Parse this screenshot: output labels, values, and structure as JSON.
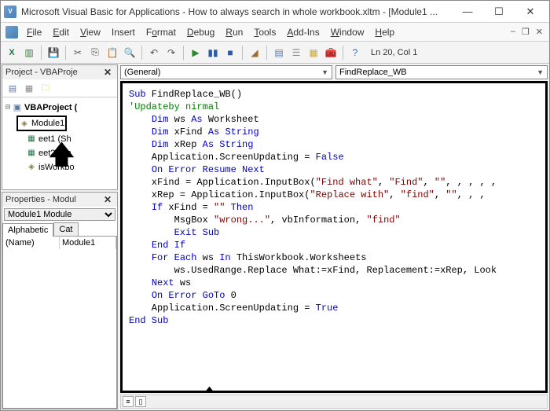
{
  "titlebar": {
    "title": "Microsoft Visual Basic for Applications - How to always search in whole workbook.xltm - [Module1 ..."
  },
  "menu": {
    "file": "File",
    "edit": "Edit",
    "view": "View",
    "insert": "Insert",
    "format": "Format",
    "debug": "Debug",
    "run": "Run",
    "tools": "Tools",
    "addins": "Add-Ins",
    "window": "Window",
    "help": "Help"
  },
  "toolbar": {
    "status": "Ln 20, Col 1"
  },
  "project": {
    "title": "Project - VBAProje",
    "root": "VBAProject (",
    "module1": "Module1",
    "sheet1": "eet1 (Sh",
    "sheet2": "eet2 (Sh",
    "thiswb": "isWorkbo"
  },
  "props": {
    "title": "Properties - Modul",
    "combo_label": "Module1",
    "combo_type": "Module",
    "tab_alpha": "Alphabetic",
    "tab_cat": "Cat",
    "row_name": "(Name)",
    "row_val": "Module1"
  },
  "code_dd": {
    "left": "(General)",
    "right": "FindReplace_WB"
  },
  "code": {
    "l1a": "Sub",
    "l1b": " FindReplace_WB()",
    "l2": "'Updateby nirmal",
    "l3a": "Dim",
    "l3b": " ws ",
    "l3c": "As",
    "l3d": " Worksheet",
    "l4a": "Dim",
    "l4b": " xFind ",
    "l4c": "As String",
    "l5a": "Dim",
    "l5b": " xRep ",
    "l5c": "As String",
    "l6a": "    Application.ScreenUpdating = ",
    "l6b": "False",
    "l7": "On Error Resume Next",
    "l8a": "    xFind = Application.InputBox(",
    "l8s1": "\"Find what\"",
    "l8c": ", ",
    "l8s2": "\"Find\"",
    "l8d": ", ",
    "l8s3": "\"\"",
    "l8e": ", , , , ,",
    "l9a": "    xRep = Application.InputBox(",
    "l9s1": "\"Replace with\"",
    "l9c": ", ",
    "l9s2": "\"find\"",
    "l9d": ", ",
    "l9s3": "\"\"",
    "l9e": ", , ,",
    "l10a": "If",
    "l10b": " xFind = ",
    "l10s": "\"\"",
    "l10c": " ",
    "l10d": "Then",
    "l11a": "        MsgBox ",
    "l11s1": "\"wrong...\"",
    "l11b": ", vbInformation, ",
    "l11s2": "\"find\"",
    "l12": "Exit Sub",
    "l13": "End If",
    "l14a": "For Each",
    "l14b": " ws ",
    "l14c": "In",
    "l14d": " ThisWorkbook.Worksheets",
    "l15": "        ws.UsedRange.Replace What:=xFind, Replacement:=xRep, Look",
    "l16a": "Next",
    "l16b": " ws",
    "l17a": "On Error GoTo",
    "l17b": " 0",
    "l18a": "    Application.ScreenUpdating = ",
    "l18b": "True",
    "l19": "End Sub"
  }
}
